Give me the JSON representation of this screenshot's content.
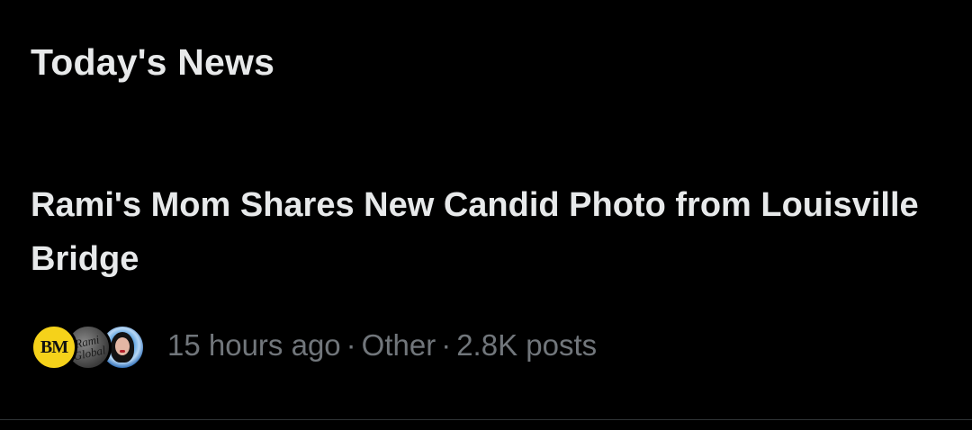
{
  "section": {
    "title": "Today's News"
  },
  "news_item": {
    "headline": "Rami's Mom Shares New Candid Photo from Louisville Bridge",
    "avatars": [
      {
        "initials": "BM",
        "color": "#f5d21a"
      },
      {
        "signature": "Rami Global",
        "color": "#5a5a5a"
      },
      {
        "color": "#3a8fd8"
      }
    ],
    "time": "15 hours ago",
    "category": "Other",
    "post_count": "2.8K posts",
    "separator": "·"
  },
  "colors": {
    "background": "#000000",
    "primary_text": "#e7e9ea",
    "secondary_text": "#71767b",
    "divider": "#2f3336"
  }
}
